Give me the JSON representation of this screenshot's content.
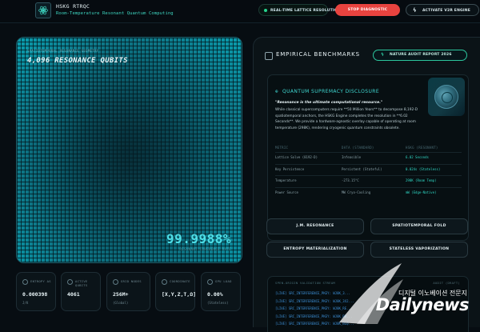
{
  "header": {
    "title": "HSKG RTRQC",
    "subtitle": "Room-Temperature Resonant Quantum Computing",
    "status_label": "REAL-TIME LATTICE RESOLUTION",
    "stop_label": "STOP DIAGNOSTIC",
    "activate_label": "ACTIVATE V2R ENGINE",
    "colors": {
      "accent": "#3ed6c1",
      "stop": "#e8433f",
      "status_dot": "#27d48f"
    }
  },
  "lattice": {
    "kicker": "SPATIOTEMPORAL RESONANCE GEOMETRY",
    "title": "4,096 RESONANCE QUBITS",
    "value": "99.9988%",
    "value_label": "RESONANT COHERENCE RATE"
  },
  "stats": [
    {
      "label": "ENTROPY ΔS",
      "value": "0.000398",
      "unit": "J/K"
    },
    {
      "label": "ACTIVE QUBITS",
      "value": "4061",
      "unit": ""
    },
    {
      "label": "GRID NODES",
      "value": "256M+",
      "unit": "(Global)"
    },
    {
      "label": "COORDINATE",
      "value": "[X,Y,Z,T,Ω]",
      "unit": ""
    },
    {
      "label": "GPU LOAD",
      "value": "0.00%",
      "unit": "(Stateless)"
    }
  ],
  "benchmarks": {
    "title": "EMPIRICAL BENCHMARKS",
    "report_label": "NATURE AUDIT REPORT 2026",
    "disclosure": {
      "title": "QUANTUM SUPREMACY DISCLOSURE",
      "quote": "\"Resonance is the ultimate computational resource.\"",
      "body": [
        "While classical supercomputers require **50 Million Years** to decompose 8,192-D",
        "spatiotemporal anchors, the HSKG Engine completes the resolution in **6.02",
        "Seconds**. We provide a hardware-agnostic overlay capable of operating at room",
        "temperature (298K), rendering cryogenic quantum constraints obsolete."
      ],
      "table": {
        "headers": [
          "METRIC",
          "DATA (STANDARD)",
          "HSKG (RESONANT)"
        ],
        "rows": [
          [
            "Lattice Solve (8192-D)",
            "Infeasible",
            "6.02 Seconds"
          ],
          [
            "Key Persistence",
            "Persistent (Stateful)",
            "0.024s (Stateless)"
          ],
          [
            "Temperature",
            "-273.15°C",
            "298K (Room Temp)"
          ],
          [
            "Power Source",
            "MW Cryo-Cooling",
            "mW (Edge-Native)"
          ]
        ]
      }
    },
    "actions": [
      "J.M. RESONANCE",
      "SPATIOTEMPORAL FOLD",
      "ENTROPY MATERIALIZATION",
      "STATELESS VAPORIZATION"
    ],
    "log": {
      "title": "SPEN-ORIGIN VALIDATION STREAM",
      "right": "AUDIT (DRAFT)",
      "lines": [
        "[LIVE] SRC_INTERFERENCE_PKEY: WJ8K_3... ",
        "[LIVE] SRC_INTERFERENCE_PKEY: WJ8K_3X2...",
        "[LIVE] SRC_INTERFERENCE_PKEY: WJ8K_RE...",
        "[LIVE] SRC_INTERFERENCE_PKEY: WJ8K_BR...",
        "[LIVE] SRC_INTERFERENCE_PKEY: WJ8K_BLQ..."
      ]
    }
  },
  "watermark": {
    "tagline": "디지털 이노베이션 전문지",
    "brand": "Dailynews"
  }
}
